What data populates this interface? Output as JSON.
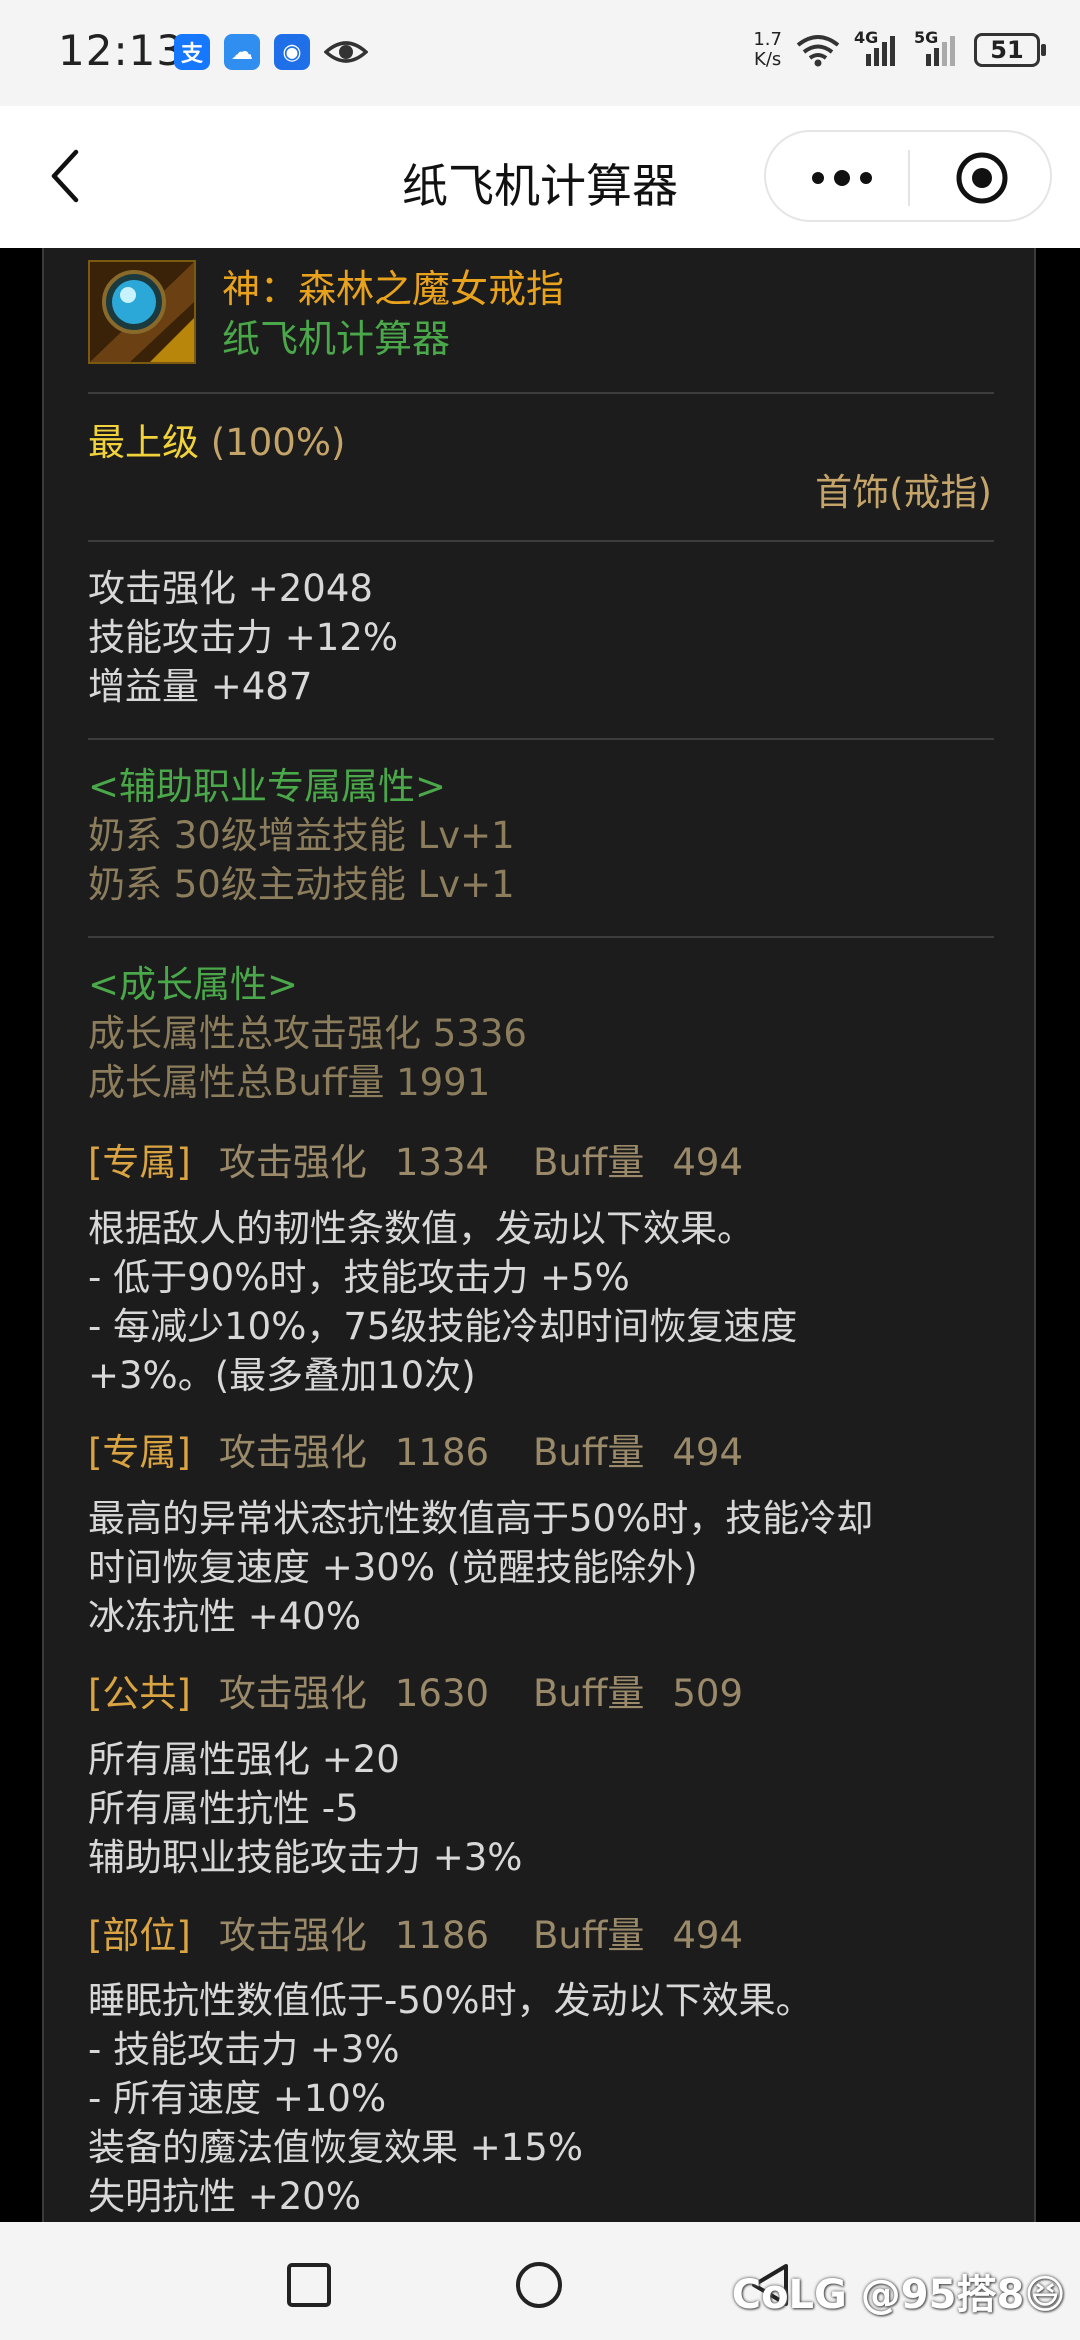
{
  "status_bar": {
    "time": "12:13",
    "net_speed_value": "1.7",
    "net_speed_unit": "K/s",
    "signal1_label": "4G",
    "signal2_label": "5G",
    "battery": "51",
    "icons": [
      "alipay-icon",
      "weather-icon",
      "bulb-app-icon",
      "eye-icon",
      "wifi-icon"
    ]
  },
  "nav": {
    "title": "纸飞机计算器",
    "back_icon": "chevron-left-icon",
    "more_icon": "more-dots-icon",
    "close_icon": "target-circle-icon"
  },
  "item": {
    "name": "神：森林之魔女戒指",
    "source": "纸飞机计算器",
    "grade": "最上级",
    "grade_pct": "(100%)",
    "slot": "首饰(戒指)"
  },
  "base_stats": [
    "攻击强化 +2048",
    "技能攻击力 +12%",
    "增益量 +487"
  ],
  "support": {
    "header": "<辅助职业专属属性>",
    "lines": [
      "奶系 30级增益技能 Lv+1",
      "奶系 50级主动技能 Lv+1"
    ]
  },
  "growth": {
    "header": "<成长属性>",
    "lines": [
      "成长属性总攻击强化 5336",
      "成长属性总Buff量 1991"
    ]
  },
  "options": [
    {
      "tag": "[专属]",
      "atk_label": "攻击强化",
      "atk": "1334",
      "buff_label": "Buff量",
      "buff": "494",
      "lines": [
        "根据敌人的韧性条数值，发动以下效果。",
        "- 低于90%时，技能攻击力 +5%",
        "- 每减少10%，75级技能冷却时间恢复速度",
        "+3%。(最多叠加10次)"
      ]
    },
    {
      "tag": "[专属]",
      "atk_label": "攻击强化",
      "atk": "1186",
      "buff_label": "Buff量",
      "buff": "494",
      "lines": [
        "最高的异常状态抗性数值高于50%时，技能冷却",
        "时间恢复速度 +30% (觉醒技能除外)",
        "冰冻抗性 +40%"
      ]
    },
    {
      "tag": "[公共]",
      "atk_label": "攻击强化",
      "atk": "1630",
      "buff_label": "Buff量",
      "buff": "509",
      "lines": [
        "所有属性强化 +20",
        "所有属性抗性 -5",
        "辅助职业技能攻击力 +3%"
      ]
    },
    {
      "tag": "[部位]",
      "atk_label": "攻击强化",
      "atk": "1186",
      "buff_label": "Buff量",
      "buff": "494",
      "lines": [
        "睡眠抗性数值低于-50%时，发动以下效果。",
        "- 技能攻击力 +3%",
        "- 所有速度 +10%",
        "装备的魔法值恢复效果 +15%",
        "失明抗性 +20%"
      ]
    }
  ],
  "system_nav": {
    "recent_icon": "square-icon",
    "home_icon": "circle-icon",
    "back_icon": "triangle-back-icon",
    "watermark": "CoLG @95搭8😆"
  }
}
